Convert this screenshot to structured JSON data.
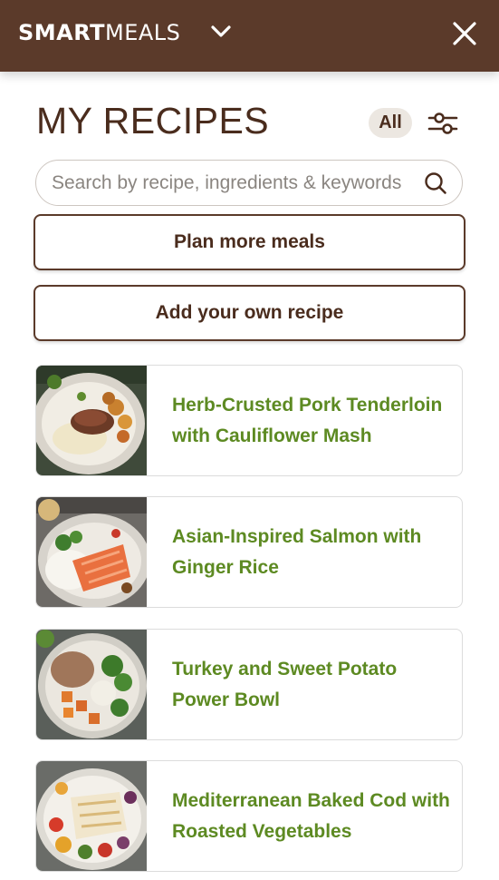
{
  "header": {
    "brand_strong": "SMART",
    "brand_light": "MEALS",
    "background_color": "#5b3a2a",
    "menu_icon": "chevron-down-icon",
    "close_icon": "close-icon"
  },
  "page": {
    "title": "MY RECIPES",
    "filter_pill": "All",
    "filter_icon": "sliders-icon"
  },
  "search": {
    "placeholder": "Search by recipe, ingredients & keywords",
    "value": "",
    "icon": "search-icon"
  },
  "actions": {
    "plan_label": "Plan more meals",
    "add_label": "Add your own recipe"
  },
  "recipes": [
    {
      "title": "Herb-Crusted Pork Tenderloin with Cauliflower Mash"
    },
    {
      "title": "Asian-Inspired Salmon with Ginger Rice"
    },
    {
      "title": "Turkey and Sweet Potato Power Bowl"
    },
    {
      "title": "Mediterranean Baked Cod with Roasted Vegetables"
    }
  ],
  "colors": {
    "brand_brown": "#5b3a2a",
    "text_brown": "#4a2c1d",
    "recipe_green": "#5d8a22",
    "pill_bg": "#ece7e1"
  }
}
